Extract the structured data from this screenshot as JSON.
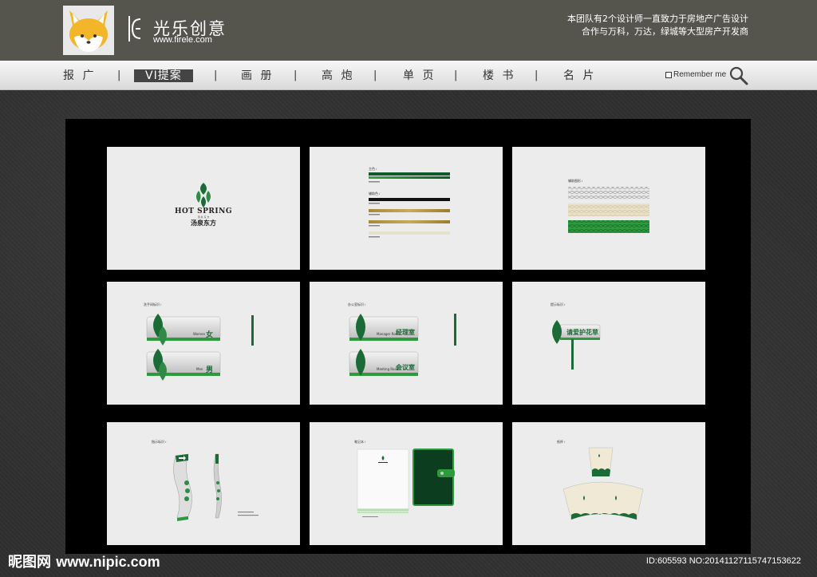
{
  "header": {
    "brand_name": "光乐创意",
    "brand_url": "www.firele.com",
    "tagline_line1": "本团队有2个设计师一直致力于房地产广告设计",
    "tagline_line2": "合作与万科，万达，绿城等大型房产开发商"
  },
  "nav": {
    "items": [
      {
        "label": "报 广"
      },
      {
        "label": "VI提案"
      },
      {
        "label": "画 册"
      },
      {
        "label": "高 炮"
      },
      {
        "label": "单 页"
      },
      {
        "label": "楼 书"
      },
      {
        "label": "名 片"
      }
    ],
    "separator": "|",
    "remember_label": "Remember me"
  },
  "cards": {
    "c1": {
      "title_en": "HOT SPRING",
      "sub_small": "汤 泉 东 方",
      "title_cn": "汤泉东方"
    },
    "c2": {
      "label1": "主色 /",
      "label2": "辅助色 /"
    },
    "c3": {
      "label": "辅助图形 /"
    },
    "c4": {
      "label": "洗手间标识 /",
      "sign1_en": "Women",
      "sign1_cn": "女",
      "sign2_en": "Men",
      "sign2_cn": "男"
    },
    "c5": {
      "label": "办公室标识 /",
      "sign1_en": "Manager Room",
      "sign1_cn": "经理室",
      "sign2_en": "Meeting Room",
      "sign2_cn": "会议室"
    },
    "c6": {
      "label": "提示标识 /",
      "sign_cn": "请爱护花草"
    },
    "c7": {
      "label": "指示标识 /"
    },
    "c8": {
      "label": "笔记本 /"
    },
    "c9": {
      "label": "纸杯 /"
    }
  },
  "watermark": {
    "left_cn": "昵图网",
    "left_url": "www.nipic.com",
    "right": "ID:605593 NO:20141127115747153622"
  },
  "colors": {
    "header_bg": "#55544d",
    "brand_green": "#1a6b35",
    "bright_green": "#2e9a3e",
    "gold": "#a88b3a"
  }
}
